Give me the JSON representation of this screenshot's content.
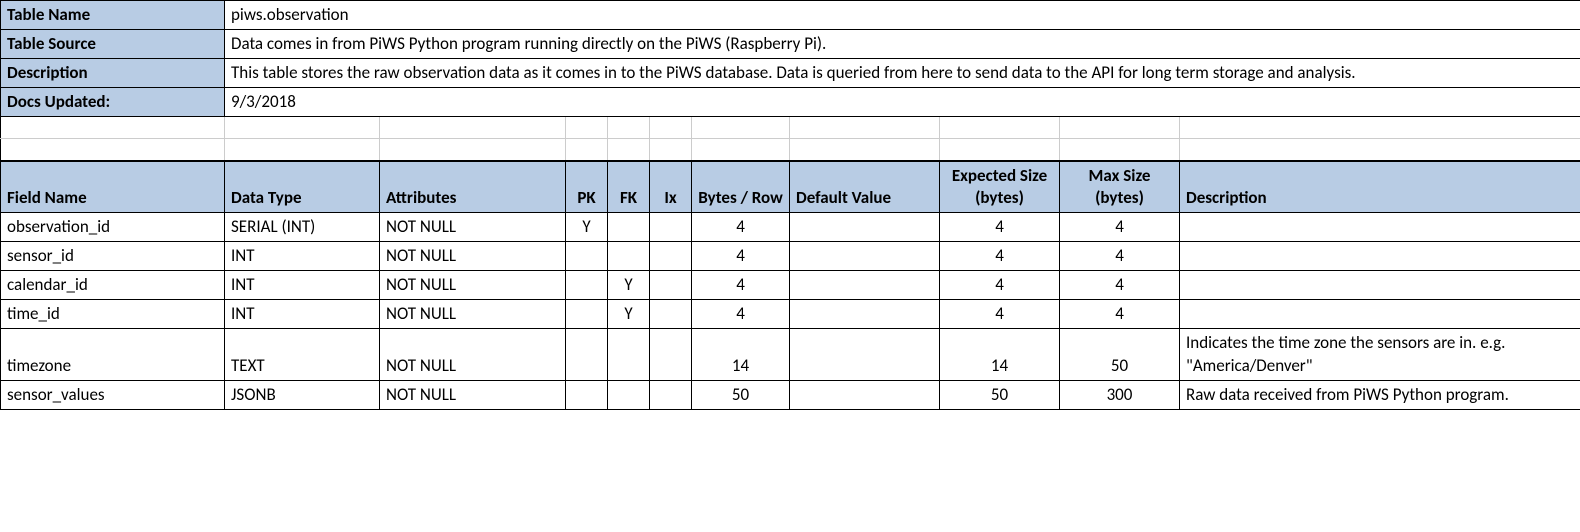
{
  "meta": {
    "tableNameLabel": "Table Name",
    "tableNameValue": "piws.observation",
    "tableSourceLabel": "Table Source",
    "tableSourceValue": "Data comes in from PiWS Python program running directly on the PiWS (Raspberry Pi).",
    "descriptionLabel": "Description",
    "descriptionValue": "This table stores the raw observation data as it comes in to the PiWS database.  Data is queried from here to send data to the API for long term storage and analysis.",
    "docsUpdatedLabel": "Docs Updated:",
    "docsUpdatedValue": "9/3/2018"
  },
  "headers": {
    "fieldName": "Field Name",
    "dataType": "Data Type",
    "attributes": "Attributes",
    "pk": "PK",
    "fk": "FK",
    "ix": "Ix",
    "bytesPerRow": "Bytes / Row",
    "defaultValue": "Default Value",
    "expectedSize": "Expected Size (bytes)",
    "maxSize": "Max Size (bytes)",
    "description": "Description"
  },
  "rows": [
    {
      "field": "observation_id",
      "type": "SERIAL (INT)",
      "attr": "NOT NULL",
      "pk": "Y",
      "fk": "",
      "ix": "",
      "bpr": "4",
      "def": "",
      "exp": "4",
      "max": "4",
      "desc": ""
    },
    {
      "field": "sensor_id",
      "type": "INT",
      "attr": "NOT NULL",
      "pk": "",
      "fk": "",
      "ix": "",
      "bpr": "4",
      "def": "",
      "exp": "4",
      "max": "4",
      "desc": ""
    },
    {
      "field": "calendar_id",
      "type": "INT",
      "attr": "NOT NULL",
      "pk": "",
      "fk": "Y",
      "ix": "",
      "bpr": "4",
      "def": "",
      "exp": "4",
      "max": "4",
      "desc": ""
    },
    {
      "field": "time_id",
      "type": "INT",
      "attr": "NOT NULL",
      "pk": "",
      "fk": "Y",
      "ix": "",
      "bpr": "4",
      "def": "",
      "exp": "4",
      "max": "4",
      "desc": ""
    },
    {
      "field": "timezone",
      "type": "TEXT",
      "attr": "NOT NULL",
      "pk": "",
      "fk": "",
      "ix": "",
      "bpr": "14",
      "def": "",
      "exp": "14",
      "max": "50",
      "desc": "Indicates the time zone the sensors are in.  e.g. \"America/Denver\""
    },
    {
      "field": "sensor_values",
      "type": "JSONB",
      "attr": "NOT NULL",
      "pk": "",
      "fk": "",
      "ix": "",
      "bpr": "50",
      "def": "",
      "exp": "50",
      "max": "300",
      "desc": "Raw data received from PiWS Python program."
    }
  ]
}
